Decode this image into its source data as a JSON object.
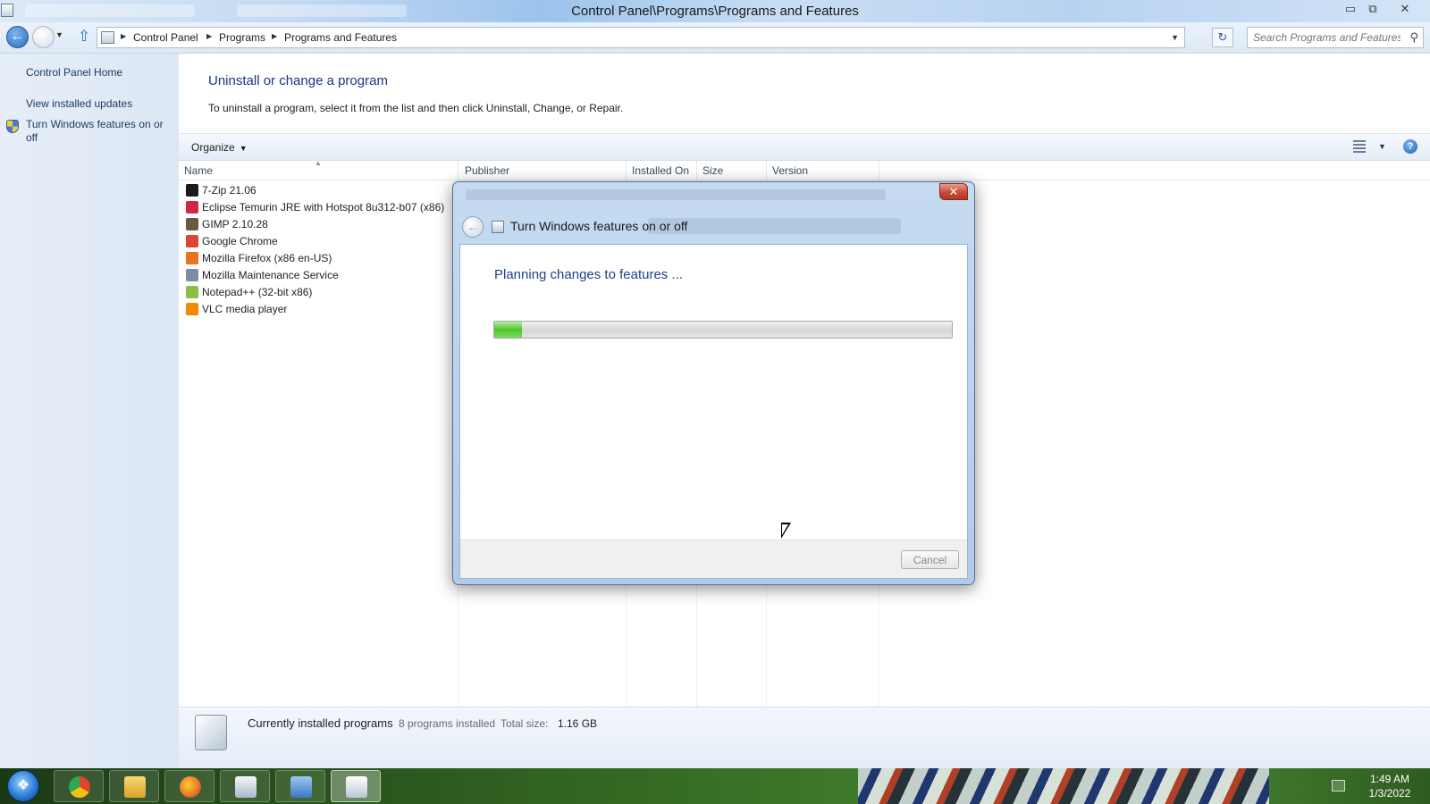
{
  "window": {
    "title": "Control Panel\\Programs\\Programs and Features",
    "minimize": "▭",
    "restore": "⧉",
    "close": "✕"
  },
  "address": {
    "crumbs": [
      "Control Panel",
      "Programs",
      "Programs and Features"
    ],
    "search_placeholder": "Search Programs and Features"
  },
  "sidebar": {
    "home": "Control Panel Home",
    "updates": "View installed updates",
    "features": "Turn Windows features on or off"
  },
  "main": {
    "title": "Uninstall or change a program",
    "description": "To uninstall a program, select it from the list and then click Uninstall, Change, or Repair.",
    "organize": "Organize",
    "columns": [
      "Name",
      "Publisher",
      "Installed On",
      "Size",
      "Version"
    ],
    "programs": [
      {
        "name": "7-Zip 21.06",
        "icon": "7zip-icon",
        "color": "#1a1a1a"
      },
      {
        "name": "Eclipse Temurin JRE with Hotspot 8u312-b07 (x86)",
        "icon": "eclipse-temurin-icon",
        "color": "#d2254a"
      },
      {
        "name": "GIMP 2.10.28",
        "icon": "gimp-icon",
        "color": "#6b5a43"
      },
      {
        "name": "Google Chrome",
        "icon": "chrome-icon",
        "color": "#e0442f"
      },
      {
        "name": "Mozilla Firefox (x86 en-US)",
        "icon": "firefox-icon",
        "color": "#e8731e"
      },
      {
        "name": "Mozilla Maintenance Service",
        "icon": "maintenance-service-icon",
        "color": "#7a8da3"
      },
      {
        "name": "Notepad++ (32-bit x86)",
        "icon": "notepadpp-icon",
        "color": "#8cbf3f"
      },
      {
        "name": "VLC media player",
        "icon": "vlc-icon",
        "color": "#f08a00"
      }
    ]
  },
  "status": {
    "title": "Currently installed programs",
    "count": "8 programs installed",
    "size_label": "Total size:",
    "size_value": "1.16 GB"
  },
  "dialog": {
    "title": "Turn Windows features on or off",
    "status_text": "Planning changes to features ...",
    "progress": 0.06,
    "cancel": "Cancel",
    "close": "✕"
  },
  "taskbar": {
    "items": [
      "chrome-icon",
      "file-explorer-icon",
      "firefox-icon",
      "control-panel-icon",
      "remote-desktop-icon",
      "programs-features-icon"
    ],
    "time": "1:49 AM",
    "date": "1/3/2022"
  },
  "colors": {
    "progress_green": "#4dc42c",
    "link_blue": "#1e3287"
  }
}
